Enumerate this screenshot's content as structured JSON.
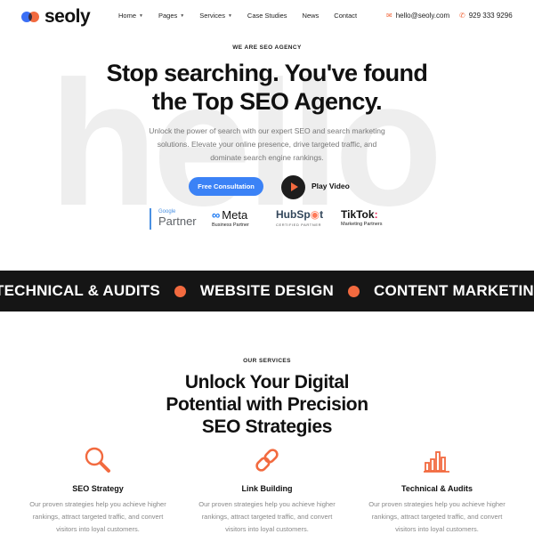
{
  "header": {
    "logo_text": "seoly",
    "nav": [
      {
        "label": "Home",
        "has_dropdown": true
      },
      {
        "label": "Pages",
        "has_dropdown": true
      },
      {
        "label": "Services",
        "has_dropdown": true
      },
      {
        "label": "Case Studies",
        "has_dropdown": false
      },
      {
        "label": "News",
        "has_dropdown": false
      },
      {
        "label": "Contact",
        "has_dropdown": false
      }
    ],
    "email": "hello@seoly.com",
    "phone": "929 333 9296",
    "email_icon": "mail-icon",
    "phone_icon": "phone-icon"
  },
  "hero": {
    "eyebrow": "WE ARE SEO AGENCY",
    "watermark": "hello",
    "title_line1": "Stop searching. You've found",
    "title_line2": "the Top SEO Agency.",
    "subtitle_line1": "Unlock the power of search with our expert SEO and search marketing",
    "subtitle_line2": "solutions. Elevate your online presence, drive targeted traffic, and",
    "subtitle_line3": "dominate search engine rankings.",
    "cta_label": "Free Consultation",
    "play_label": "Play Video"
  },
  "partners": {
    "google_small": "Google",
    "google_big": "Partner",
    "meta_name": "Meta",
    "meta_sub": "Business Partner",
    "hubspot_name_a": "HubSp",
    "hubspot_name_b": "t",
    "hubspot_sub": "CERTIFIED PARTNER",
    "tiktok_name": "TikTok",
    "tiktok_sub": "Marketing Partners"
  },
  "ticker": {
    "items": [
      "TECHNICAL & AUDITS",
      "WEBSITE DESIGN",
      "CONTENT MARKETING"
    ]
  },
  "services": {
    "eyebrow": "OUR SERVICES",
    "title_line1": "Unlock Your Digital",
    "title_line2": "Potential with Precision",
    "title_line3": "SEO Strategies",
    "cards": [
      {
        "title": "SEO Strategy",
        "icon": "magnifier-icon",
        "line1": "Our proven strategies help you achieve higher",
        "line2": "rankings, attract targeted traffic, and convert",
        "line3": "visitors into loyal customers."
      },
      {
        "title": "Link Building",
        "icon": "link-icon",
        "line1": "Our proven strategies help you achieve higher",
        "line2": "rankings, attract targeted traffic, and convert",
        "line3": "visitors into loyal customers."
      },
      {
        "title": "Technical & Audits",
        "icon": "bar-chart-icon",
        "line1": "Our proven strategies help you achieve higher",
        "line2": "rankings, attract targeted traffic, and convert",
        "line3": "visitors into loyal customers."
      }
    ],
    "accent_color": "#f26a3f"
  },
  "colors": {
    "brand_blue": "#3b82f6",
    "brand_orange": "#f26a3f",
    "dark_band": "#151515"
  }
}
